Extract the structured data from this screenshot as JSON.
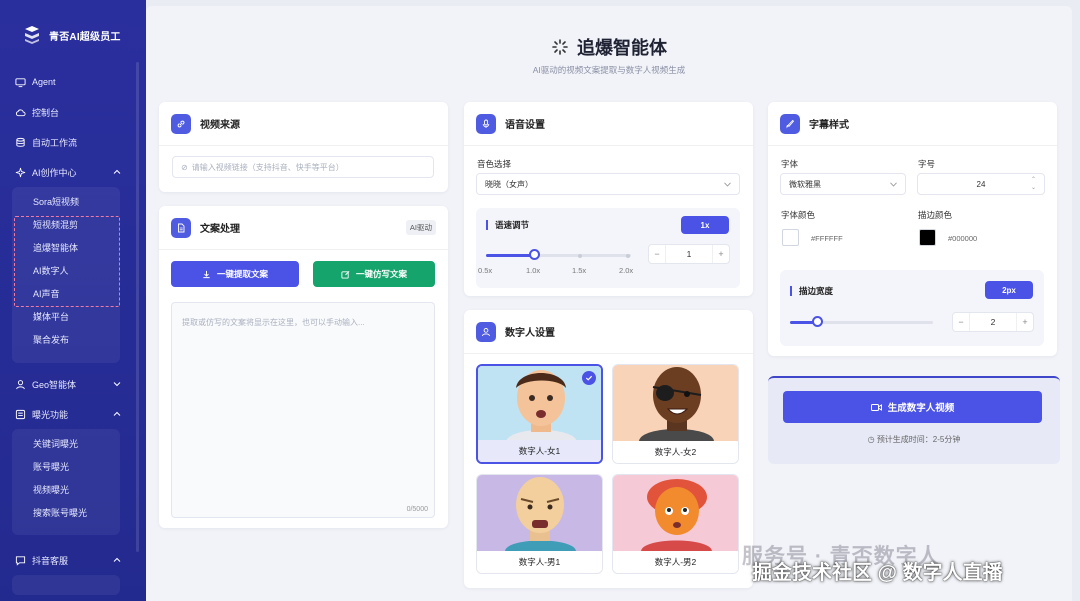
{
  "brand": {
    "name": "青否AI超级员工"
  },
  "sidebar": {
    "top_items": [
      {
        "label": "Agent",
        "icon": "monitor-icon"
      },
      {
        "label": "控制台",
        "icon": "cloud-icon"
      },
      {
        "label": "自动工作流",
        "icon": "database-icon"
      }
    ],
    "ai_center": {
      "label": "AI创作中心",
      "items": [
        "Sora短视频",
        "短视频混剪",
        "追爆智能体",
        "AI数字人",
        "AI声音",
        "媒体平台",
        "聚合发布"
      ]
    },
    "geo": {
      "label": "Geo智能体"
    },
    "exposure": {
      "label": "曝光功能",
      "items": [
        "关键词曝光",
        "账号曝光",
        "视频曝光",
        "搜索账号曝光"
      ]
    },
    "service": {
      "label": "抖音客服"
    }
  },
  "header": {
    "title": "追爆智能体",
    "subtitle": "AI驱动的视频文案提取与数字人视频生成"
  },
  "video_source": {
    "title": "视频来源",
    "placeholder": "请输入视频链接（支持抖音、快手等平台）"
  },
  "copy_processing": {
    "title": "文案处理",
    "tag": "AI驱动",
    "extract_button": "一键提取文案",
    "rewrite_button": "一键仿写文案",
    "textarea_placeholder": "提取或仿写的文案将显示在这里，也可以手动输入...",
    "char_count": "0/5000"
  },
  "voice": {
    "title": "语音设置",
    "timbre_label": "音色选择",
    "timbre_value": "晓晓（女声）",
    "speed_title": "语速调节",
    "speed_value": "1x",
    "speed_ticks": [
      "0.5x",
      "1.0x",
      "1.5x",
      "2.0x"
    ],
    "speed_stepper_value": "1",
    "speed_level": 1.0
  },
  "digital_human": {
    "title": "数字人设置",
    "avatars": [
      {
        "name": "数字人-女1",
        "selected": true
      },
      {
        "name": "数字人-女2",
        "selected": false
      },
      {
        "name": "数字人-男1",
        "selected": false
      },
      {
        "name": "数字人-男2",
        "selected": false
      }
    ]
  },
  "subtitle_style": {
    "title": "字幕样式",
    "font_label": "字体",
    "font_value": "微软雅黑",
    "size_label": "字号",
    "size_value": "24",
    "font_color_label": "字体颜色",
    "font_color_hex": "#FFFFFF",
    "stroke_color_label": "描边颜色",
    "stroke_color_hex": "#000000",
    "stroke_width_title": "描边宽度",
    "stroke_width_value": "2px",
    "stroke_stepper_value": "2"
  },
  "generate": {
    "button": "生成数字人视频",
    "estimate": "预计生成时间：2-5分钟"
  },
  "watermark": {
    "line1": "服务号 · 青否数字人",
    "line2": "掘金技术社区 @ 数字人直播"
  },
  "colors": {
    "sidebar": "#262c96",
    "accent": "#4b52e6",
    "green": "#14a46c",
    "highlight_box": "#f07aa6"
  }
}
